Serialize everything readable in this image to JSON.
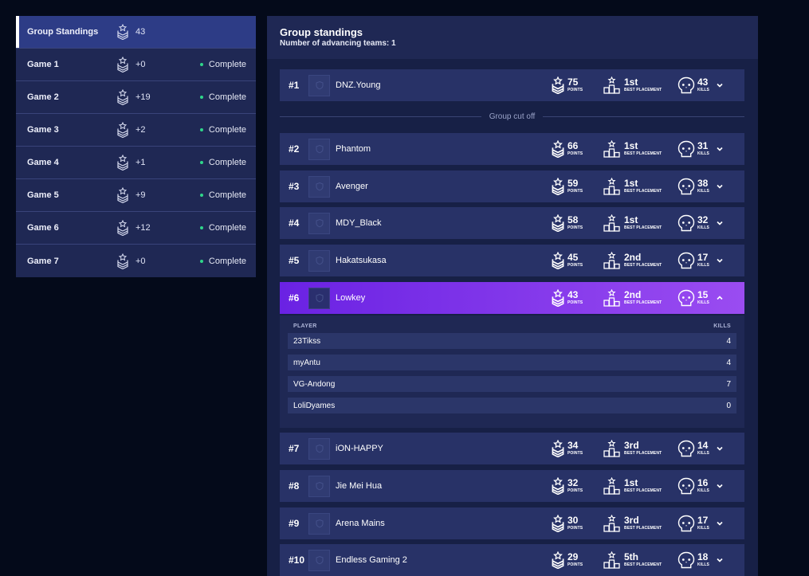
{
  "sidebar": {
    "items": [
      {
        "name": "Group Standings",
        "points": "43",
        "status": ""
      },
      {
        "name": "Game 1",
        "points": "+0",
        "status": "Complete"
      },
      {
        "name": "Game 2",
        "points": "+19",
        "status": "Complete"
      },
      {
        "name": "Game 3",
        "points": "+2",
        "status": "Complete"
      },
      {
        "name": "Game 4",
        "points": "+1",
        "status": "Complete"
      },
      {
        "name": "Game 5",
        "points": "+9",
        "status": "Complete"
      },
      {
        "name": "Game 6",
        "points": "+12",
        "status": "Complete"
      },
      {
        "name": "Game 7",
        "points": "+0",
        "status": "Complete"
      }
    ]
  },
  "header": {
    "title": "Group standings",
    "subtitle": "Number of advancing teams: 1"
  },
  "labels": {
    "points": "POINTS",
    "best_placement": "BEST PLACEMENT",
    "kills": "KILLS",
    "cutoff": "Group cut off",
    "player_col": "PLAYER",
    "kills_col": "KILLS"
  },
  "teams": [
    {
      "rank": "#1",
      "name": "DNZ.Young",
      "points": "75",
      "placement": "1st",
      "kills": "43"
    },
    {
      "rank": "#2",
      "name": "Phantom",
      "points": "66",
      "placement": "1st",
      "kills": "31"
    },
    {
      "rank": "#3",
      "name": "Avenger",
      "points": "59",
      "placement": "1st",
      "kills": "38"
    },
    {
      "rank": "#4",
      "name": "MDY_Black",
      "points": "58",
      "placement": "1st",
      "kills": "32"
    },
    {
      "rank": "#5",
      "name": "Hakatsukasa",
      "points": "45",
      "placement": "2nd",
      "kills": "17"
    },
    {
      "rank": "#6",
      "name": "Lowkey",
      "points": "43",
      "placement": "2nd",
      "kills": "15"
    },
    {
      "rank": "#7",
      "name": "iON-HAPPY",
      "points": "34",
      "placement": "3rd",
      "kills": "14"
    },
    {
      "rank": "#8",
      "name": "Jie Mei Hua",
      "points": "32",
      "placement": "1st",
      "kills": "16"
    },
    {
      "rank": "#9",
      "name": "Arena Mains",
      "points": "30",
      "placement": "3rd",
      "kills": "17"
    },
    {
      "rank": "#10",
      "name": "Endless Gaming 2",
      "points": "29",
      "placement": "5th",
      "kills": "18"
    }
  ],
  "expanded_players": [
    {
      "name": "23Tikss",
      "kills": "4"
    },
    {
      "name": "myAntu",
      "kills": "4"
    },
    {
      "name": "VG-Andong",
      "kills": "7"
    },
    {
      "name": "LoliDyames",
      "kills": "0"
    }
  ],
  "colors": {
    "background": "#040a1a",
    "panel": "#1f2854",
    "row": "#283267",
    "active_sidebar": "#2d3c86",
    "expanded_gradient_start": "#6a22e3",
    "expanded_gradient_end": "#9a4cf1",
    "status_dot": "#2fd68a"
  },
  "icons": {
    "points": "chevron-rank-icon",
    "placement": "podium-icon",
    "kills": "skull-icon",
    "expand": "chevron-down-icon",
    "collapse": "chevron-up-icon",
    "team_logo": "team-logo-icon"
  }
}
